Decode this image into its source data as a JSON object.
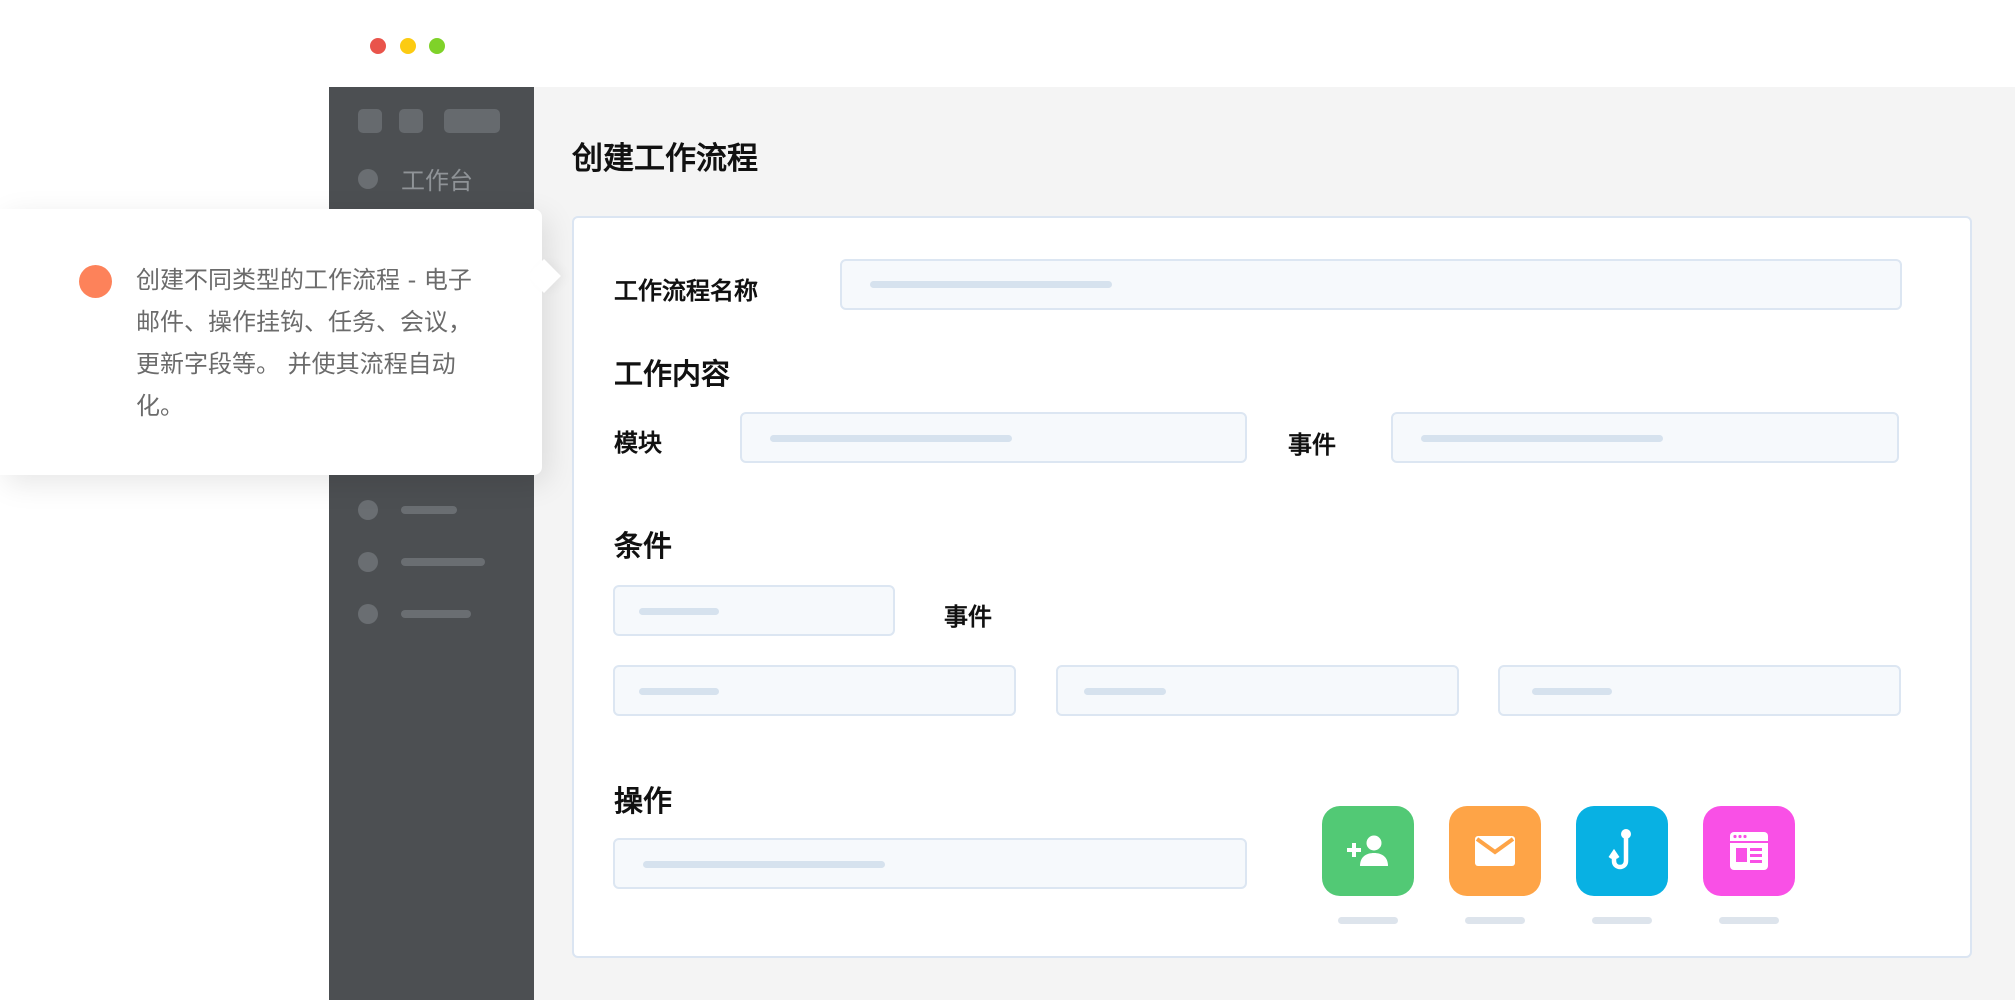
{
  "window": {
    "controls": [
      {
        "name": "close",
        "color": "#e9544b"
      },
      {
        "name": "minimize",
        "color": "#fccb12"
      },
      {
        "name": "maximize",
        "color": "#7fd229"
      }
    ]
  },
  "sidebar": {
    "workspace_label": "工作台"
  },
  "callout": {
    "accent_color": "#fd825a",
    "text": "创建不同类型的工作流程 - 电子邮件、操作挂钩、任务、会议，更新字段等。 并使其流程自动化。"
  },
  "page": {
    "title": "创建工作流程"
  },
  "form": {
    "workflow_name_label": "工作流程名称",
    "content_section": "工作内容",
    "module_label": "模块",
    "event_label": "事件",
    "condition_section": "条件",
    "condition_event_label": "事件",
    "action_section": "操作"
  },
  "actions": [
    {
      "icon": "add-user-icon",
      "color": "#52c975"
    },
    {
      "icon": "email-icon",
      "color": "#fea447"
    },
    {
      "icon": "hook-icon",
      "color": "#08b1e3"
    },
    {
      "icon": "web-page-icon",
      "color": "#f950e6"
    }
  ]
}
